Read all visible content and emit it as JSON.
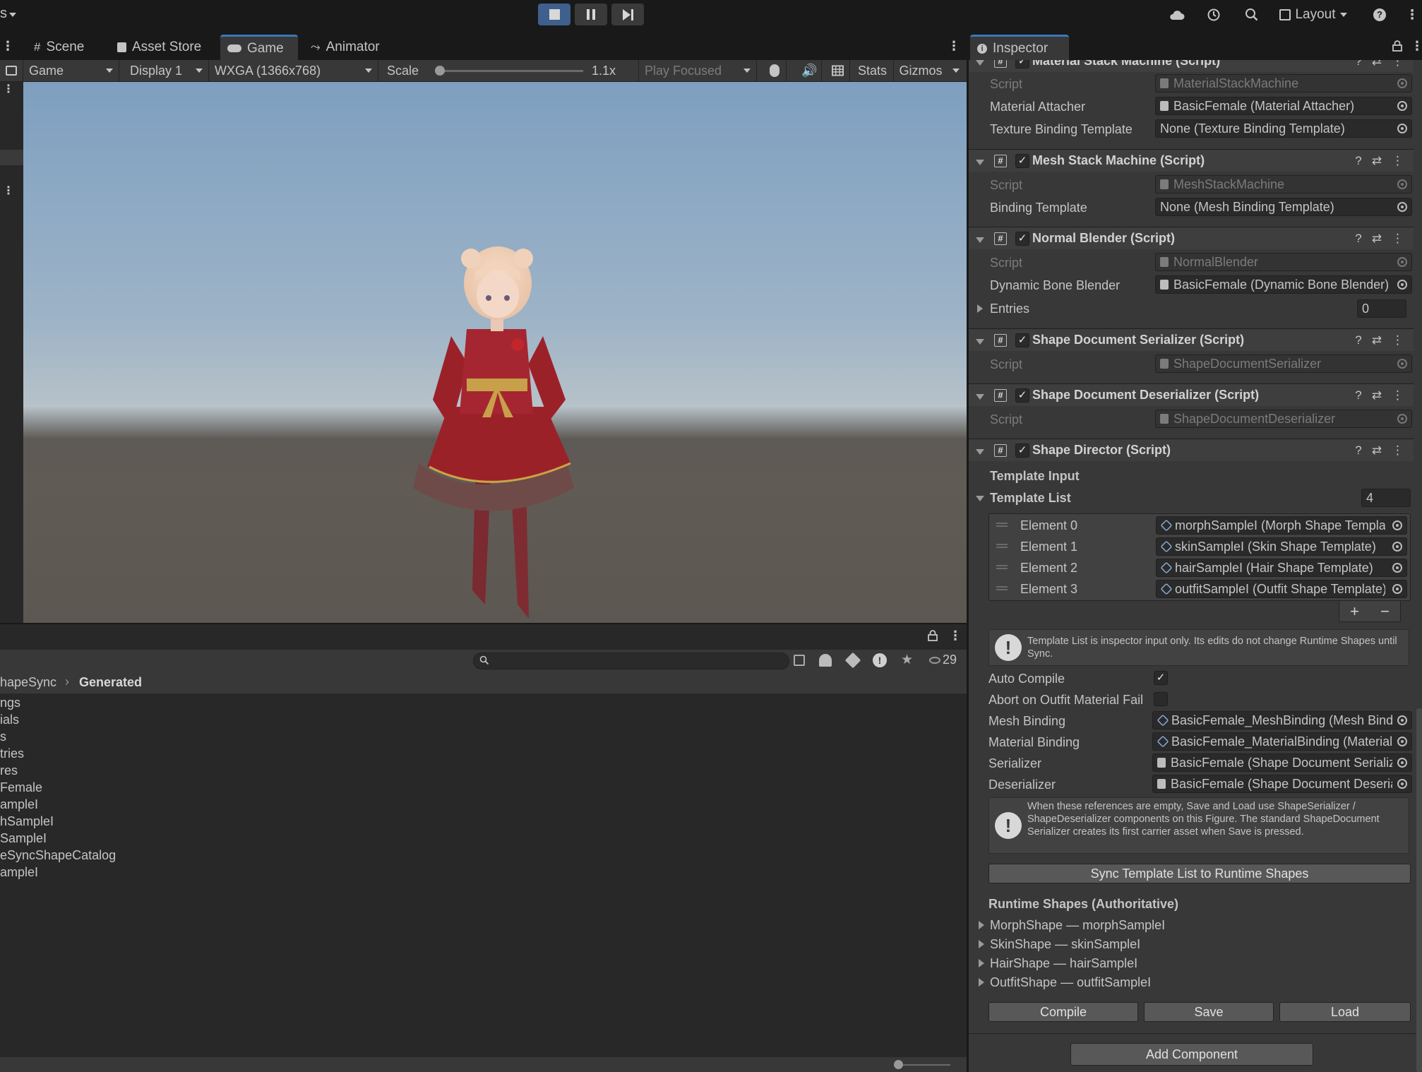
{
  "toolbar": {
    "left_fragment": "s",
    "layout_label": "Layout"
  },
  "left_tabs": [
    {
      "label": "Scene"
    },
    {
      "label": "Asset Store"
    },
    {
      "label": "Game"
    },
    {
      "label": "Animator"
    }
  ],
  "game_bar": {
    "view_mode": "Game",
    "display": "Display 1",
    "resolution": "WXGA (1366x768)",
    "scale_label": "Scale",
    "scale_value": "1.1x",
    "play_mode": "Play Focused",
    "stats_label": "Stats",
    "gizmos_label": "Gizmos"
  },
  "project": {
    "visible_count": "29",
    "breadcrumb": [
      "hapeSync",
      "Generated"
    ],
    "items": [
      "ngs",
      "ials",
      "s",
      "tries",
      "res",
      "Female",
      "ampleI",
      "hSampleI",
      "SampleI",
      "eSyncShapeCatalog",
      "ampleI"
    ]
  },
  "inspector": {
    "tab_label": "Inspector",
    "material_stack": {
      "title": "Material Stack Machine (Script)",
      "script_label": "Script",
      "script_value": "MaterialStackMachine",
      "attacher_label": "Material Attacher",
      "attacher_value": "BasicFemale (Material Attacher)",
      "texture_label": "Texture Binding Template",
      "texture_value": "None (Texture Binding Template)"
    },
    "mesh_stack": {
      "title": "Mesh Stack Machine (Script)",
      "script_label": "Script",
      "script_value": "MeshStackMachine",
      "binding_label": "Binding Template",
      "binding_value": "None (Mesh Binding Template)"
    },
    "normal_blender": {
      "title": "Normal Blender (Script)",
      "script_label": "Script",
      "script_value": "NormalBlender",
      "dbb_label": "Dynamic Bone Blender",
      "dbb_value": "BasicFemale (Dynamic Bone Blender)",
      "entries_label": "Entries",
      "entries_value": "0"
    },
    "serializer": {
      "title": "Shape Document Serializer (Script)",
      "script_label": "Script",
      "script_value": "ShapeDocumentSerializer"
    },
    "deserializer": {
      "title": "Shape Document Deserializer (Script)",
      "script_label": "Script",
      "script_value": "ShapeDocumentDeserializer"
    },
    "director": {
      "title": "Shape Director (Script)",
      "template_input": "Template Input",
      "template_list_label": "Template List",
      "template_list_count": "4",
      "elements": [
        {
          "label": "Element 0",
          "value": "morphSampleI (Morph Shape Template)"
        },
        {
          "label": "Element 1",
          "value": "skinSampleI (Skin Shape Template)"
        },
        {
          "label": "Element 2",
          "value": "hairSampleI (Hair Shape Template)"
        },
        {
          "label": "Element 3",
          "value": "outfitSampleI (Outfit Shape Template)"
        }
      ],
      "add_symbol": "+",
      "remove_symbol": "−",
      "help1": "Template List is inspector input only. Its edits do not change Runtime Shapes until Sync.",
      "auto_compile_label": "Auto Compile",
      "abort_label": "Abort on Outfit Material Fail",
      "mesh_binding_label": "Mesh Binding",
      "mesh_binding_value": "BasicFemale_MeshBinding (Mesh Binding Template)",
      "material_binding_label": "Material Binding",
      "material_binding_value": "BasicFemale_MaterialBinding (Material Binding Template)",
      "serializer_label": "Serializer",
      "serializer_value": "BasicFemale (Shape Document Serializer)",
      "deserializer_label": "Deserializer",
      "deserializer_value": "BasicFemale (Shape Document Deserializer)",
      "help2": "When these references are empty, Save and Load use ShapeSerializer / ShapeDeserializer components on this Figure. The standard ShapeDocument Serializer creates its first carrier asset when Save is pressed.",
      "sync_button": "Sync Template List to Runtime Shapes",
      "runtime_header": "Runtime Shapes (Authoritative)",
      "runtime_items": [
        "MorphShape — morphSampleI",
        "SkinShape — skinSampleI",
        "HairShape — hairSampleI",
        "OutfitShape — outfitSampleI"
      ],
      "compile_button": "Compile",
      "save_button": "Save",
      "load_button": "Load"
    },
    "add_component_button": "Add Component"
  }
}
